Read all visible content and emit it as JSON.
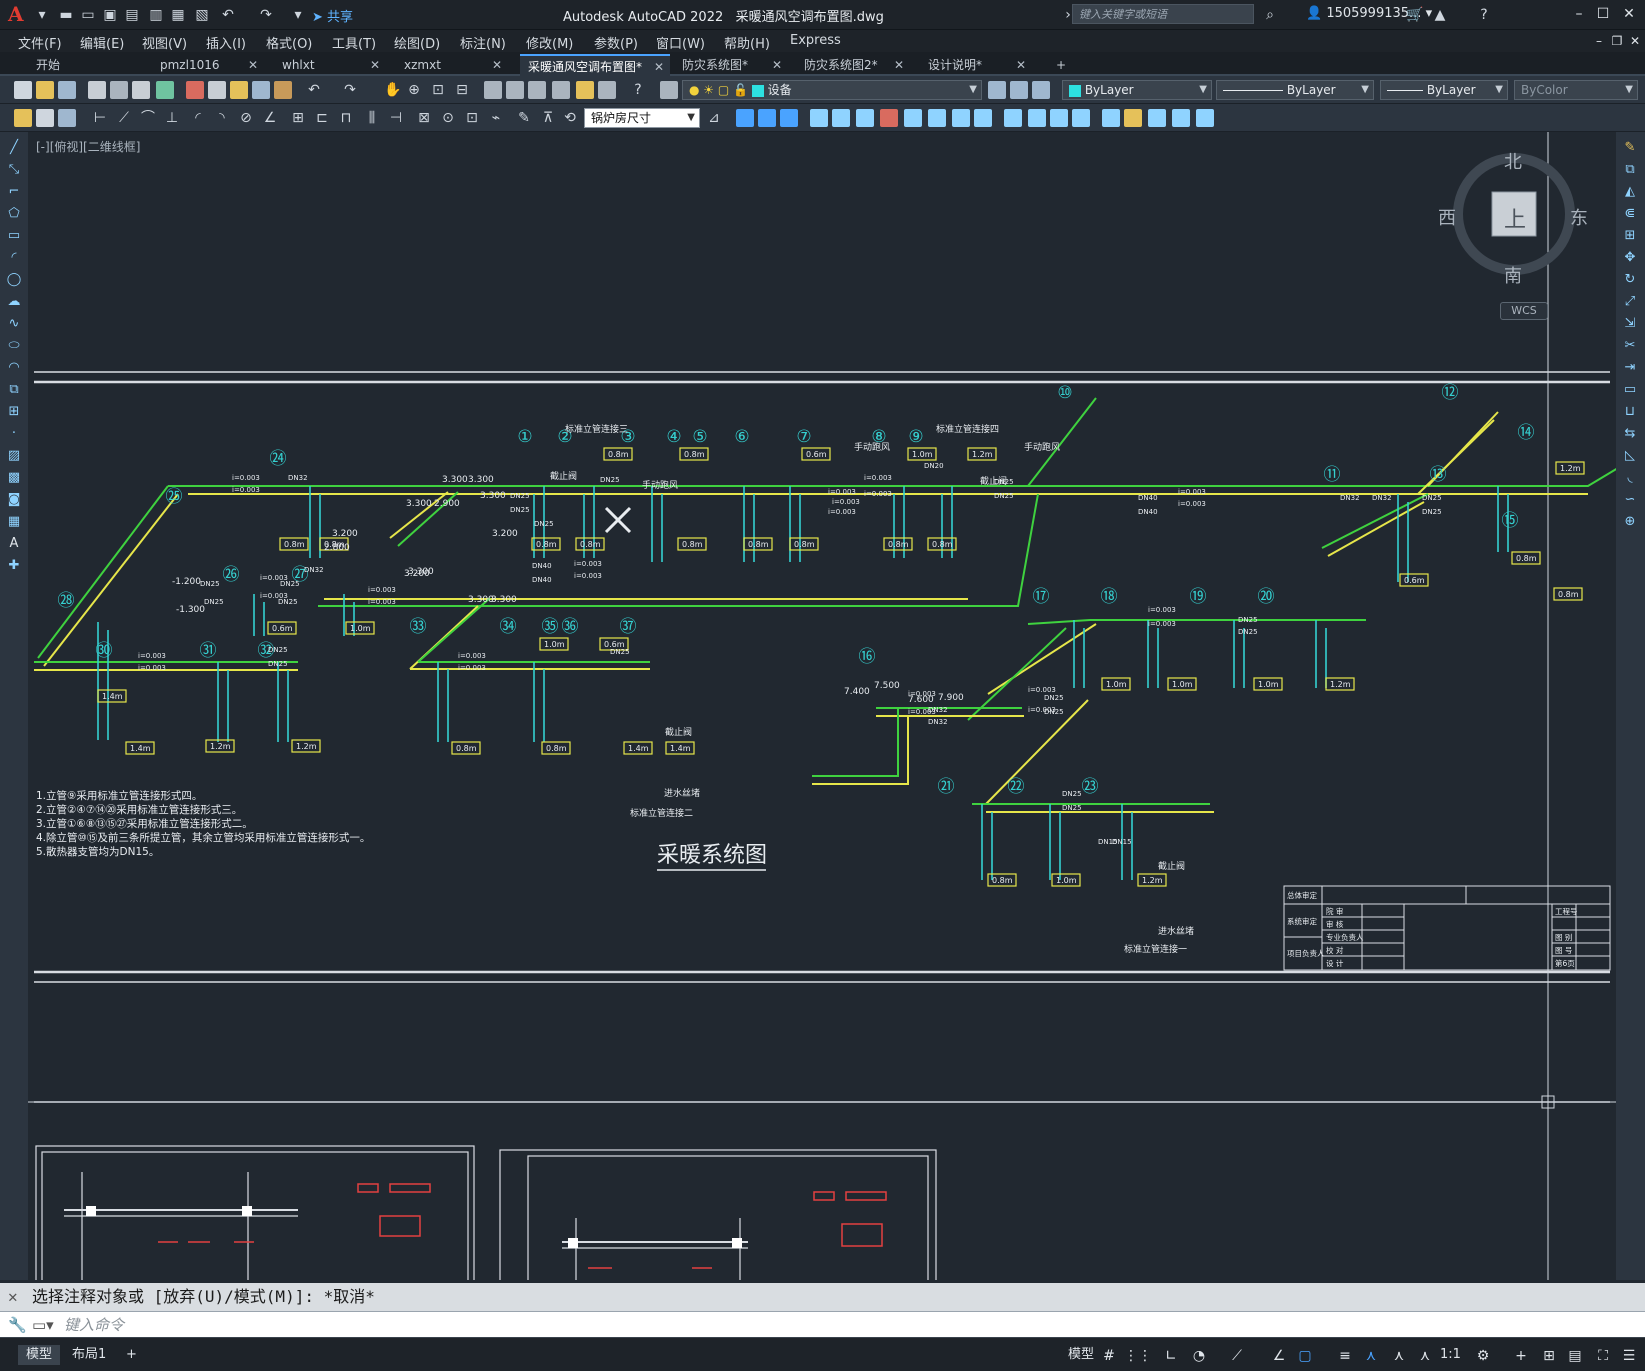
{
  "app": {
    "title": "Autodesk AutoCAD 2022",
    "document": "采暖通风空调布置图.dwg",
    "share_label": "共享",
    "search_placeholder": "键入关键字或短语",
    "user": "1505999135...",
    "logo": "A"
  },
  "menu": [
    "文件(F)",
    "编辑(E)",
    "视图(V)",
    "插入(I)",
    "格式(O)",
    "工具(T)",
    "绘图(D)",
    "标注(N)",
    "修改(M)",
    "参数(P)",
    "窗口(W)",
    "帮助(H)",
    "Express"
  ],
  "tabs": [
    {
      "label": "开始",
      "active": false,
      "close": ""
    },
    {
      "label": "pmzl1016",
      "active": false,
      "close": "✕"
    },
    {
      "label": "whlxt",
      "active": false,
      "close": "✕"
    },
    {
      "label": "xzmxt",
      "active": false,
      "close": "✕"
    },
    {
      "label": "采暖通风空调布置图*",
      "active": true,
      "close": "✕"
    },
    {
      "label": "防灾系统图*",
      "active": false,
      "close": "✕"
    },
    {
      "label": "防灾系统图2*",
      "active": false,
      "close": "✕"
    },
    {
      "label": "设计说明*",
      "active": false,
      "close": "✕"
    }
  ],
  "new_tab": "+",
  "toolbar": {
    "layer": "设备",
    "color": "ByLayer",
    "linetype": "ByLayer",
    "lineweight": "ByLayer",
    "plotstyle": "ByColor",
    "dimstyle": "锅炉房尺寸"
  },
  "viewport_label": "[-][俯视][二维线框]",
  "viewcube": {
    "north": "北",
    "south": "南",
    "east": "东",
    "west": "西",
    "top": "上",
    "wcs": "WCS"
  },
  "drawing": {
    "title": "采暖系统图",
    "label_std3": "标准立管连接三",
    "label_std4": "标准立管连接四",
    "label_std2": "标准立管连接二",
    "label_std1": "标准立管连接一",
    "valve": "截止阀",
    "manual_vent": "手动跑风",
    "inlet": "进水丝堵",
    "notes": [
      "1.立管⑨采用标准立管连接形式四。",
      "2.立管②④⑦⑭⑳采用标准立管连接形式三。",
      "3.立管①⑥⑧⑬⑮㉗采用标准立管连接形式二。",
      "4.除立管⑩⑮及前三条所提立管，其余立管均采用标准立管连接形式一。",
      "5.散热器支管均为DN15。"
    ],
    "risers_top": [
      "①",
      "②",
      "③",
      "④",
      "⑤",
      "⑥",
      "⑦",
      "⑧",
      "⑨",
      "⑩",
      "⑪",
      "⑫",
      "⑬",
      "⑭",
      "⑮"
    ],
    "risers_left": [
      "㉔",
      "㉕",
      "㉖",
      "㉗",
      "㉘",
      "㉚",
      "㉛",
      "㉜"
    ],
    "risers_mid": [
      "㉝",
      "㉞",
      "㉟",
      "㊱",
      "㊲"
    ],
    "risers_right": [
      "⑯",
      "⑰",
      "⑱",
      "⑲",
      "⑳",
      "㉑",
      "㉒",
      "㉓"
    ],
    "sizes": [
      "0.8m",
      "1.0m",
      "1.2m",
      "1.4m",
      "0.6m"
    ],
    "pipes": [
      "DN25",
      "DN32",
      "DN40",
      "DN20",
      "DN15"
    ],
    "slope": "i=0.003",
    "levels": [
      "3.300",
      "2.900",
      "3.200",
      "2.800",
      "-1.200",
      "-1.300",
      "7.400",
      "7.500",
      "7.600",
      "7.900"
    ],
    "tb_rows": [
      "院  审",
      "审  核",
      "专业负责人",
      "校  对",
      "设  计"
    ],
    "tb_left": [
      "总体审定",
      "系统审定",
      "项目负责人"
    ],
    "tb_right": [
      "工程号",
      "图  别",
      "图  号",
      "第6页"
    ]
  },
  "command": {
    "history": "选择注释对象或 [放弃(U)/模式(M)]: *取消*",
    "placeholder": "键入命令"
  },
  "status": {
    "layout_tabs": [
      "模型",
      "布局1"
    ],
    "add": "+",
    "model": "模型",
    "scale": "1:1"
  },
  "colors": {
    "background": "#212830",
    "pipe_green": "#3fd23f",
    "pipe_yellow": "#e6e64a",
    "riser_cyan": "#35d0d0",
    "accent": "#4aa3ff"
  }
}
